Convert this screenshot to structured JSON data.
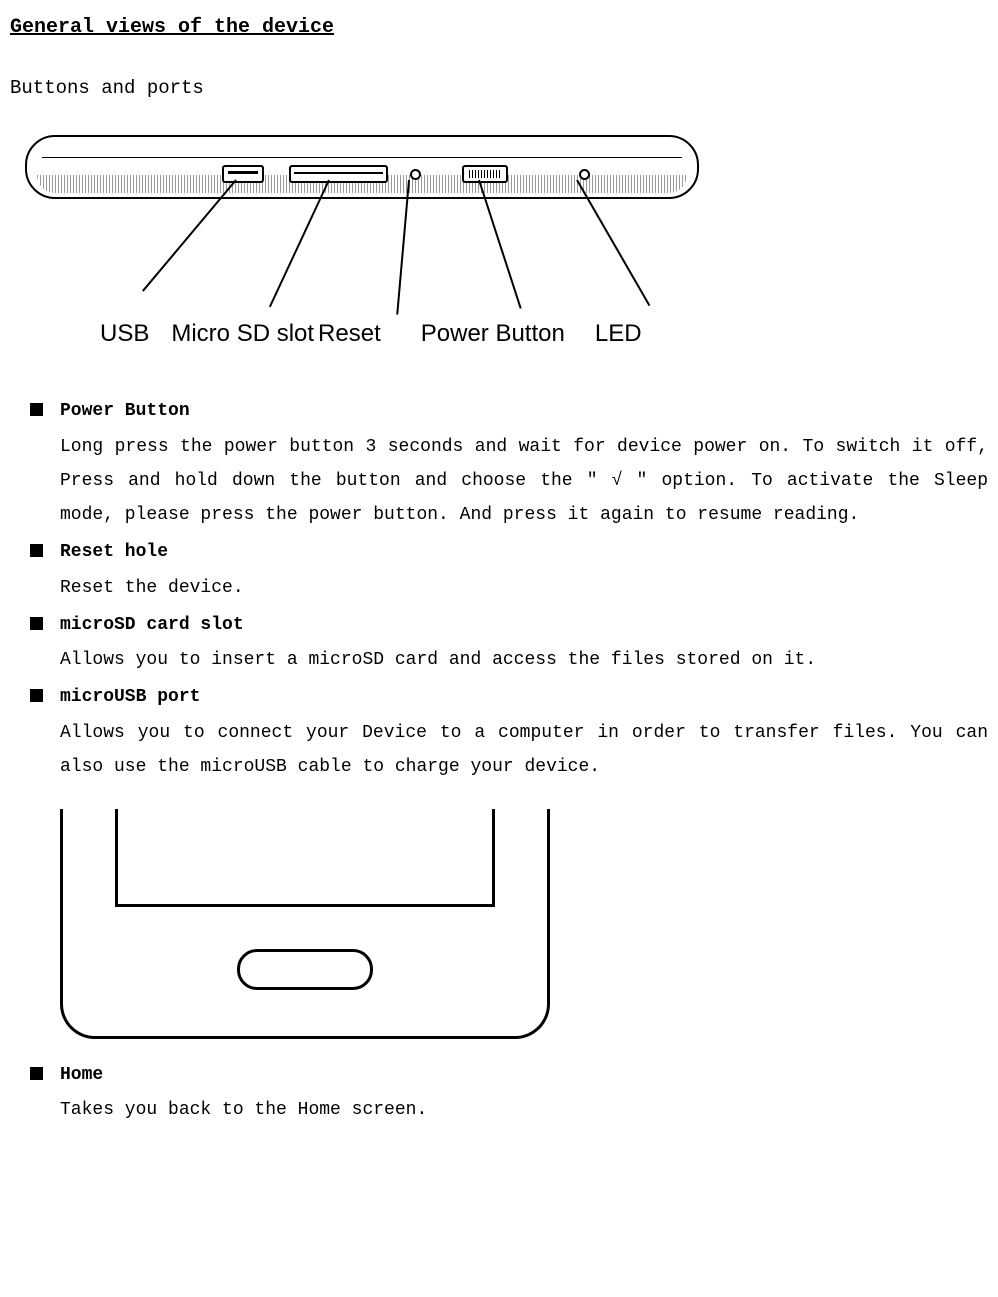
{
  "heading": "General views of the device",
  "subtitle": "Buttons and ports",
  "diagram_labels": {
    "usb": "USB",
    "microsd": "Micro SD slot",
    "reset": "Reset",
    "power": "Power Button",
    "led": "LED"
  },
  "sections": [
    {
      "title": "Power Button",
      "body": "Long press the power button 3 seconds and wait for device power on. To switch it off, Press and hold down the button and choose the \" √ \" option. To activate the Sleep mode, please press the power button. And press it again to resume reading.",
      "justified": true
    },
    {
      "title": "Reset hole",
      "body": "Reset the device."
    },
    {
      "title": "microSD card slot",
      "body": "Allows you to insert a microSD card and access the files stored on it.",
      "justified": true
    },
    {
      "title": "microUSB port",
      "body": "Allows you to connect your Device to a computer in order to transfer files. You can also use the microUSB cable to charge your device.",
      "justified": true
    }
  ],
  "home_section": {
    "title": "Home",
    "body": "Takes you back to the Home screen."
  }
}
